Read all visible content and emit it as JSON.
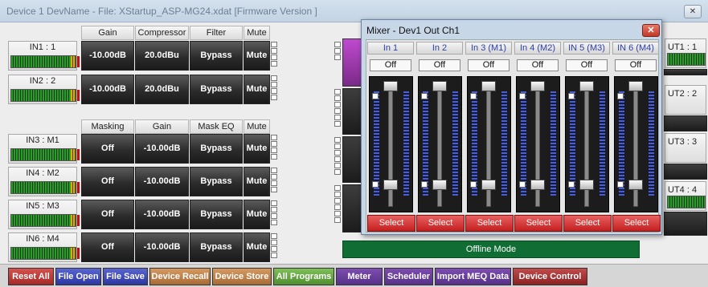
{
  "window": {
    "title": "Device 1 DevName  -  File: XStartup_ASP-MG24.xdat [Firmware Version ]",
    "close_glyph": "✕"
  },
  "top_headers": [
    "Gain",
    "Compressor",
    "Filter",
    "Mute"
  ],
  "mid_headers": [
    "Masking",
    "Gain",
    "Mask EQ",
    "Mute"
  ],
  "inputs_top": [
    {
      "name": "IN1 : 1",
      "gain": "-10.00dB",
      "comp": "20.0dBu",
      "filter": "Bypass",
      "mute": "Mute"
    },
    {
      "name": "IN2 : 2",
      "gain": "-10.00dB",
      "comp": "20.0dBu",
      "filter": "Bypass",
      "mute": "Mute"
    }
  ],
  "inputs_mask": [
    {
      "name": "IN3 : M1",
      "masking": "Off",
      "gain": "-10.00dB",
      "eq": "Bypass",
      "mute": "Mute"
    },
    {
      "name": "IN4 : M2",
      "masking": "Off",
      "gain": "-10.00dB",
      "eq": "Bypass",
      "mute": "Mute"
    },
    {
      "name": "IN5 : M3",
      "masking": "Off",
      "gain": "-10.00dB",
      "eq": "Bypass",
      "mute": "Mute"
    },
    {
      "name": "IN6 : M4",
      "masking": "Off",
      "gain": "-10.00dB",
      "eq": "Bypass",
      "mute": "Mute"
    }
  ],
  "outputs": [
    "UT1 : 1",
    "UT2 : 2",
    "UT3 : 3",
    "UT4 : 4"
  ],
  "offline_mode": "Offline Mode",
  "toolbar": [
    {
      "label": "Reset All",
      "style": "tb-red"
    },
    {
      "label": "File Open",
      "style": "tb-blue"
    },
    {
      "label": "File Save",
      "style": "tb-blue"
    },
    {
      "label": "Device Recall",
      "style": "tb-orange"
    },
    {
      "label": "Device Store",
      "style": "tb-orange"
    },
    {
      "label": "All Programs",
      "style": "tb-green"
    },
    {
      "label": "Meter",
      "style": "tb-purple"
    },
    {
      "label": "Scheduler",
      "style": "tb-purple"
    },
    {
      "label": "Import MEQ Data",
      "style": "tb-purple"
    },
    {
      "label": "Device Control",
      "style": "tb-dred"
    }
  ],
  "mixer": {
    "title": "Mixer - Dev1 Out Ch1",
    "close_glyph": "✕",
    "channels": [
      {
        "label": "In 1",
        "state": "Off",
        "select": "Select"
      },
      {
        "label": "In 2",
        "state": "Off",
        "select": "Select"
      },
      {
        "label": "In 3 (M1)",
        "state": "Off",
        "select": "Select"
      },
      {
        "label": "In 4 (M2)",
        "state": "Off",
        "select": "Select"
      },
      {
        "label": "IN 5 (M3)",
        "state": "Off",
        "select": "Select"
      },
      {
        "label": "IN 6 (M4)",
        "state": "Off",
        "select": "Select"
      }
    ]
  },
  "colors": {
    "accent_select": "#d32f2f",
    "offline_bg": "#106e35",
    "meter_green": "#2e9a2e"
  }
}
